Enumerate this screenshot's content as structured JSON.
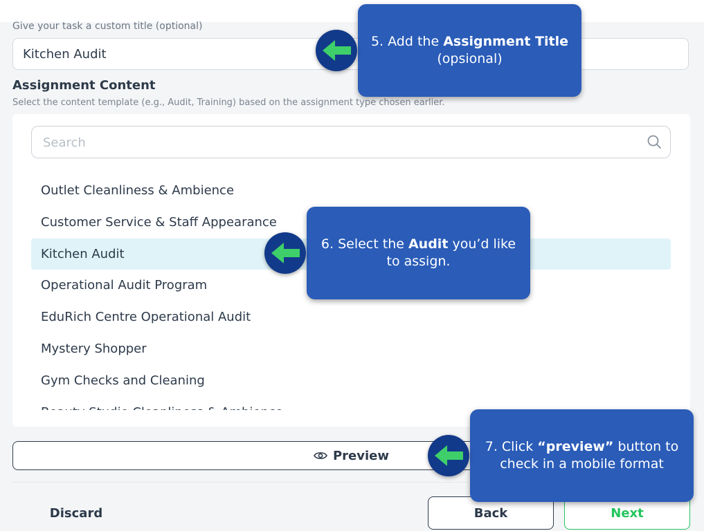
{
  "form": {
    "custom_title_label": "Give your task a custom title (optional)",
    "custom_title_value": "Kitchen Audit"
  },
  "assignment_content": {
    "title": "Assignment Content",
    "subtitle": "Select the content template (e.g., Audit, Training) based on the assignment type chosen earlier.",
    "search_placeholder": "Search",
    "search_icon": "magnifier",
    "items": [
      {
        "label": "Outlet Cleanliness & Ambience"
      },
      {
        "label": "Customer Service & Staff Appearance"
      },
      {
        "label": "Kitchen Audit"
      },
      {
        "label": "Operational Audit Program"
      },
      {
        "label": "EduRich Centre Operational Audit"
      },
      {
        "label": "Mystery Shopper"
      },
      {
        "label": "Gym Checks and Cleaning"
      },
      {
        "label": "Beauty Studio Cleanliness & Ambience"
      }
    ],
    "selected": "Kitchen Audit",
    "selected_color": "#e0f3f8"
  },
  "actions": {
    "preview_label": "Preview",
    "preview_icon": "eye-icon",
    "discard_label": "Discard",
    "back_label": "Back",
    "next_label": "Next",
    "next_color": "#22c55e"
  },
  "callouts": {
    "step5": {
      "prefix": "5. Add the ",
      "bold": "Assignment Title",
      "suffix": "(opsional)"
    },
    "step6": {
      "prefix": "6. Select the ",
      "bold": "Audit",
      "suffix": " you’d like to assign."
    },
    "step7": {
      "prefix": "7. Click ",
      "bold": "“preview”",
      "suffix": " button to check in a mobile format"
    },
    "color": "#2a5cb8",
    "arrow_color": "#3ecf6a",
    "arrow_icon": "arrow-left-icon"
  }
}
